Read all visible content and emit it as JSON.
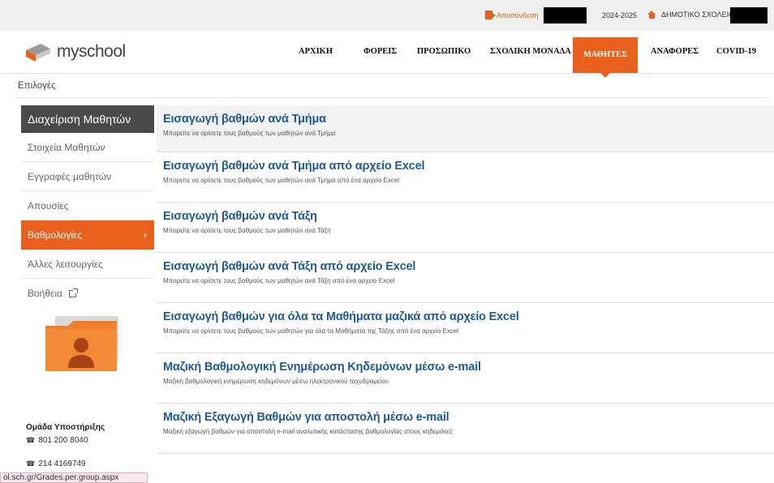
{
  "topbar": {
    "logout_label": "Αποσύνδεση",
    "school_year": "2024-2025",
    "school_label": "ΔΗΜΟΤΙΚΟ ΣΧΟΛΕΙΟ"
  },
  "brand": {
    "name": "myschool",
    "accent_color": "#e8601c",
    "link_color": "#1e5a9c"
  },
  "nav": {
    "items": [
      "ΑΡΧΙΚΗ",
      "ΦΟΡΕΙΣ",
      "ΠΡΟΣΩΠΙΚΟ",
      "ΣΧΟΛΙΚΗ ΜΟΝΑΔΑ",
      "ΜΑΘΗΤΕΣ",
      "ΑΝΑΦΟΡΕΣ",
      "COVID-19"
    ],
    "active": "ΜΑΘΗΤΕΣ"
  },
  "breadcrumb": {
    "label": "Επιλογές"
  },
  "sidebar": {
    "heading": "Διαχείριση Μαθητών",
    "items": [
      {
        "label": "Στοιχεία Μαθητών"
      },
      {
        "label": "Εγγραφές μαθητών"
      },
      {
        "label": "Απουσίες"
      },
      {
        "label": "Βαθμολογίες"
      },
      {
        "label": "Άλλες λειτουργίες"
      },
      {
        "label": "Βοήθεια"
      }
    ],
    "active_index": 3,
    "support": {
      "title": "Ομάδα Υποστήριξης",
      "phone1": "801 200 8040",
      "phone2": "214 4169749"
    }
  },
  "entries": [
    {
      "title": "Εισαγωγή βαθμών ανά Τμήμα",
      "desc": "Μπορείτε να ορίσετε τους βαθμούς των μαθητών ανά Τμήμα"
    },
    {
      "title": "Εισαγωγή βαθμών ανά Τμήμα από αρχείο Excel",
      "desc": "Μπορείτε να ορίσετε τους βαθμούς των μαθητών ανά Τμήμα από ένα αρχείο Excel"
    },
    {
      "title": "Εισαγωγή βαθμών ανά Τάξη",
      "desc": "Μπορείτε να ορίσετε τους βαθμούς των μαθητών ανά Τάξη"
    },
    {
      "title": "Εισαγωγή βαθμών ανά Τάξη από αρχείο Excel",
      "desc": "Μπορείτε να ορίσετε τους βαθμούς των μαθητών ανά Τάξη από ένα αρχείο Excel"
    },
    {
      "title": "Εισαγωγή βαθμών για όλα τα Μαθήματα μαζικά από αρχείο Excel",
      "desc": "Μπορείτε να ορίσετε τους βαθμούς των μαθητών για όλα τα Μαθήματα της Τάξης από ένα αρχείο Excel"
    },
    {
      "title": "Μαζική Βαθμολογική Ενημέρωση Κηδεμόνων μέσω e-mail",
      "desc": "Μαζική βαθμολογική ενημέρωση κηδεμόνων μέσω ηλεκτρονικού ταχυδρομείου"
    },
    {
      "title": "Μαζική Εξαγωγή Βαθμών για αποστολή μέσω e-mail",
      "desc": "Μαζική εξαγωγή βαθμών για αποστολή e-mail αναλυτικής κατάστασης βαθμολογίας στους κηδεμόνες"
    }
  ],
  "statusbar": {
    "url": "ol.sch.gr/Grades.per.group.aspx"
  }
}
